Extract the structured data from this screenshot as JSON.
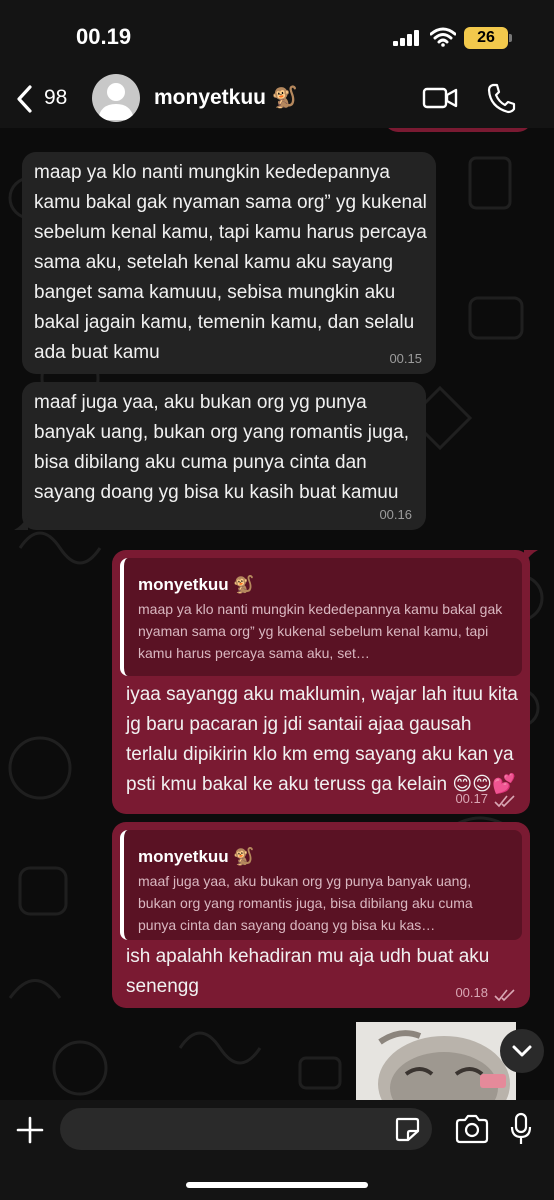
{
  "status_bar": {
    "time": "00.19",
    "battery": "26"
  },
  "header": {
    "back_count": "98",
    "contact_name": "monyetkuu 🐒"
  },
  "messages": [
    {
      "text": "maap ya klo nanti mungkin kededepannya kamu bakal gak nyaman sama org” yg kukenal sebelum kenal kamu, tapi kamu harus percaya sama aku, setelah kenal kamu aku sayang banget sama kamuuu, sebisa mungkin aku bakal jagain kamu, temenin kamu, dan selalu ada buat kamu",
      "time": "00.15"
    },
    {
      "text": "maaf juga yaa, aku bukan org yg punya banyak uang, bukan org yang romantis juga, bisa dibilang aku cuma punya cinta dan sayang doang yg bisa ku kasih buat kamuu",
      "time": "00.16"
    },
    {
      "quote_name": "monyetkuu 🐒",
      "quote_text": "maap ya klo nanti mungkin kededepannya kamu bakal gak nyaman sama org” yg kukenal sebelum kenal kamu, tapi kamu harus percaya sama aku, set…",
      "text": "iyaa sayangg aku maklumin, wajar lah ituu kita jg baru pacaran jg jdi santaii ajaa gausah terlalu dipikirin klo km emg sayang aku kan ya psti kmu bakal ke aku teruss ga kelain 😊😊💕",
      "time": "00.17"
    },
    {
      "quote_name": "monyetkuu 🐒",
      "quote_text": "maaf juga yaa, aku bukan org yg punya banyak uang, bukan org yang romantis juga, bisa dibilang aku cuma punya cinta dan sayang doang yg bisa ku kas…",
      "text": "ish apalahh kehadiran mu aja udh buat aku senengg",
      "time": "00.18"
    }
  ],
  "colors": {
    "incoming": "#232323",
    "outgoing": "#7a1a32",
    "quote": "#5a1224",
    "battery": "#f2c94c"
  },
  "icons": [
    "back-chevron-icon",
    "video-call-icon",
    "phone-icon",
    "plus-icon",
    "sticker-icon",
    "camera-icon",
    "mic-icon",
    "chevron-down-icon",
    "read-ticks-icon"
  ]
}
